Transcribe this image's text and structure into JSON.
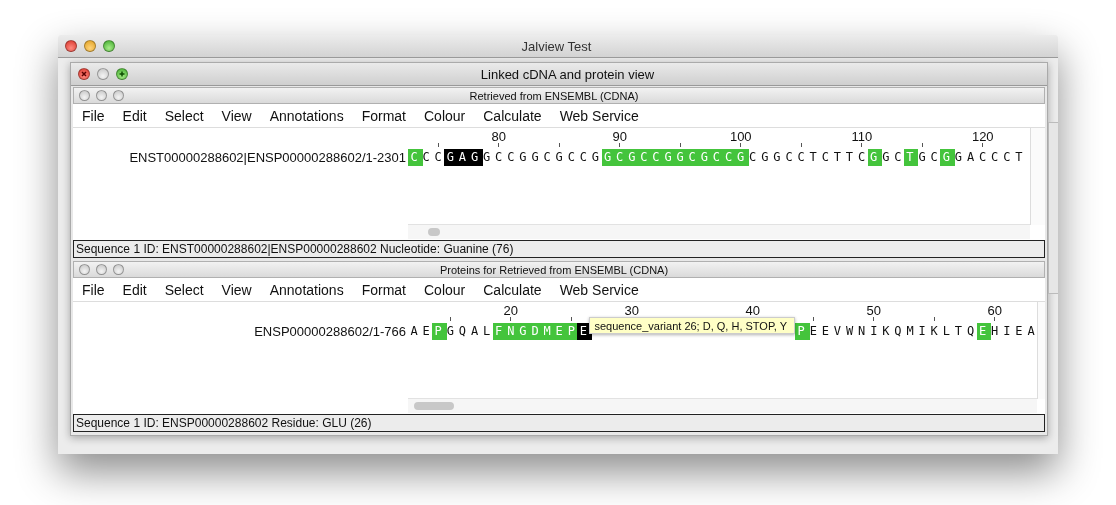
{
  "window": {
    "title": "Jalview Test"
  },
  "internal_frame": {
    "title": "Linked cDNA and protein view"
  },
  "panels": [
    {
      "title": "Retrieved from ENSEMBL (CDNA)",
      "menu": [
        "File",
        "Edit",
        "Select",
        "View",
        "Annotations",
        "Format",
        "Colour",
        "Calculate",
        "Web Service"
      ],
      "ruler": [
        "80",
        "90",
        "100",
        "110",
        "120"
      ],
      "sequence": {
        "id": "ENST00000288602|ENSP00000288602/1-2301",
        "segments": [
          {
            "text": "C",
            "kind": "feature"
          },
          {
            "text": "CC",
            "kind": "plain"
          },
          {
            "text": "GAG",
            "kind": "selected"
          },
          {
            "text": "GCCGGCGCCG",
            "kind": "plain"
          },
          {
            "text": "GCGCCGGCGCCG",
            "kind": "feature"
          },
          {
            "text": "CGGCCTCTTC",
            "kind": "plain"
          },
          {
            "text": "G",
            "kind": "feature"
          },
          {
            "text": "GC",
            "kind": "plain"
          },
          {
            "text": "T",
            "kind": "feature"
          },
          {
            "text": "GC",
            "kind": "plain"
          },
          {
            "text": "G",
            "kind": "feature"
          },
          {
            "text": "GACCCT",
            "kind": "plain"
          }
        ]
      },
      "status": "Sequence 1 ID: ENST00000288602|ENSP00000288602 Nucleotide: Guanine (76)"
    },
    {
      "title": "Proteins for Retrieved from ENSEMBL (CDNA)",
      "menu": [
        "File",
        "Edit",
        "Select",
        "View",
        "Annotations",
        "Format",
        "Colour",
        "Calculate",
        "Web Service"
      ],
      "ruler": [
        "20",
        "30",
        "40",
        "50",
        "60"
      ],
      "sequence": {
        "id": "ENSP00000288602/1-766",
        "segments": [
          {
            "text": "AE",
            "kind": "plain"
          },
          {
            "text": "P",
            "kind": "feature"
          },
          {
            "text": "GQAL",
            "kind": "plain"
          },
          {
            "text": "FNGDMEP",
            "kind": "feature"
          },
          {
            "text": "E",
            "kind": "selected"
          },
          {
            "text": "sequence_variant 26; D, Q, H, STOP, Y",
            "kind": "tooltip"
          },
          {
            "text": "P",
            "kind": "feature"
          },
          {
            "text": "EEVWNIKQMIKLTQ",
            "kind": "plain"
          },
          {
            "text": "E",
            "kind": "feature"
          },
          {
            "text": "HIEA",
            "kind": "plain"
          }
        ]
      },
      "status": "Sequence 1 ID: ENSP00000288602 Residue: GLU (26)"
    }
  ]
}
